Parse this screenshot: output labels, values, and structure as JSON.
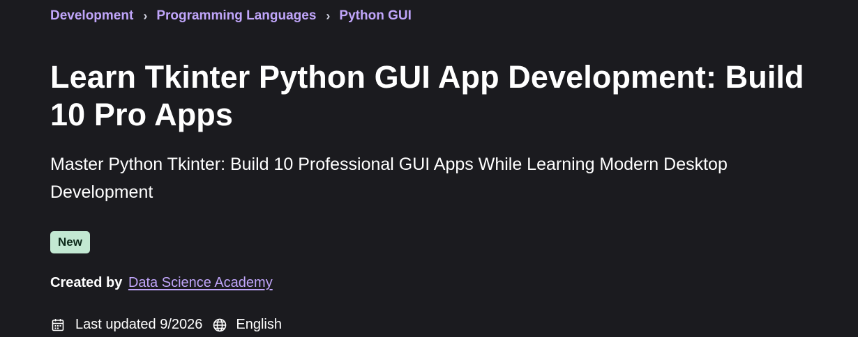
{
  "breadcrumb": {
    "items": [
      {
        "label": "Development"
      },
      {
        "label": "Programming Languages"
      },
      {
        "label": "Python GUI"
      }
    ],
    "separator": "›"
  },
  "course": {
    "title": "Learn Tkinter Python GUI App Development: Build 10 Pro Apps",
    "subtitle": "Master Python Tkinter: Build 10 Professional GUI Apps While Learning Modern Desktop Development",
    "badge": "New",
    "created_prefix": "Created by",
    "instructor": "Data Science Academy",
    "last_updated": "Last updated 9/2026",
    "language": "English"
  },
  "icons": {
    "calendar": "calendar-icon",
    "globe": "globe-icon"
  },
  "colors": {
    "background": "#1b1b1f",
    "link": "#c0a5fa",
    "badge_bg": "#c2e8d2",
    "badge_text": "#0d2a1b"
  }
}
